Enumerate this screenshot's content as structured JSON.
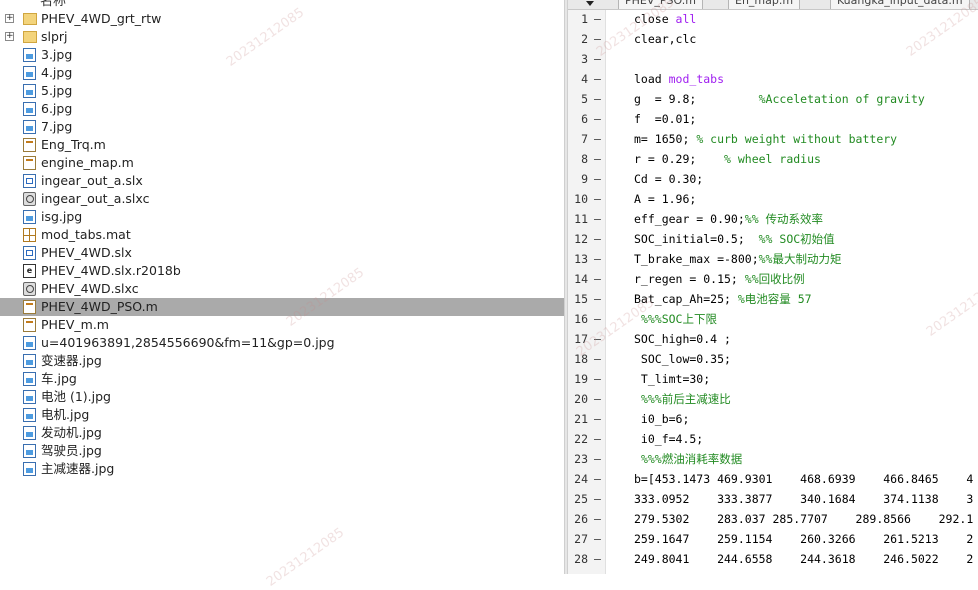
{
  "file_browser": {
    "header_clip": "名称",
    "items": [
      {
        "name": "PHEV_4WD_grt_rtw",
        "type": "folder",
        "expandable": true,
        "selected": false
      },
      {
        "name": "slprj",
        "type": "folder",
        "expandable": true,
        "selected": false
      },
      {
        "name": "3.jpg",
        "type": "jpg",
        "expandable": false,
        "selected": false
      },
      {
        "name": "4.jpg",
        "type": "jpg",
        "expandable": false,
        "selected": false
      },
      {
        "name": "5.jpg",
        "type": "jpg",
        "expandable": false,
        "selected": false
      },
      {
        "name": "6.jpg",
        "type": "jpg",
        "expandable": false,
        "selected": false
      },
      {
        "name": "7.jpg",
        "type": "jpg",
        "expandable": false,
        "selected": false
      },
      {
        "name": "Eng_Trq.m",
        "type": "m",
        "expandable": false,
        "selected": false
      },
      {
        "name": "engine_map.m",
        "type": "m",
        "expandable": false,
        "selected": false
      },
      {
        "name": "ingear_out_a.slx",
        "type": "slx",
        "expandable": false,
        "selected": false
      },
      {
        "name": "ingear_out_a.slxc",
        "type": "slxc",
        "expandable": false,
        "selected": false
      },
      {
        "name": "isg.jpg",
        "type": "jpg",
        "expandable": false,
        "selected": false
      },
      {
        "name": "mod_tabs.mat",
        "type": "mat",
        "expandable": false,
        "selected": false
      },
      {
        "name": "PHEV_4WD.slx",
        "type": "slx",
        "expandable": false,
        "selected": false
      },
      {
        "name": "PHEV_4WD.slx.r2018b",
        "type": "r2018",
        "expandable": false,
        "selected": false
      },
      {
        "name": "PHEV_4WD.slxc",
        "type": "slxc",
        "expandable": false,
        "selected": false
      },
      {
        "name": "PHEV_4WD_PSO.m",
        "type": "m",
        "expandable": false,
        "selected": true
      },
      {
        "name": "PHEV_m.m",
        "type": "m",
        "expandable": false,
        "selected": false
      },
      {
        "name": "u=401963891,2854556690&fm=11&gp=0.jpg",
        "type": "jpg",
        "expandable": false,
        "selected": false
      },
      {
        "name": "变速器.jpg",
        "type": "jpg",
        "expandable": false,
        "selected": false
      },
      {
        "name": "车.jpg",
        "type": "jpg",
        "expandable": false,
        "selected": false
      },
      {
        "name": "电池 (1).jpg",
        "type": "jpg",
        "expandable": false,
        "selected": false
      },
      {
        "name": "电机.jpg",
        "type": "jpg",
        "expandable": false,
        "selected": false
      },
      {
        "name": "发动机.jpg",
        "type": "jpg",
        "expandable": false,
        "selected": false
      },
      {
        "name": "驾驶员.jpg",
        "type": "jpg",
        "expandable": false,
        "selected": false
      },
      {
        "name": "主减速器.jpg",
        "type": "jpg",
        "expandable": false,
        "selected": false
      }
    ]
  },
  "editor": {
    "tabs": [
      {
        "label": "PHEV_PSO.m"
      },
      {
        "label": "Eh_map.m"
      },
      {
        "label": "Kuangka_input_data.m"
      }
    ],
    "lines": [
      {
        "n": "1",
        "parts": [
          {
            "t": "close ",
            "c": ""
          },
          {
            "t": "all",
            "c": "str"
          }
        ]
      },
      {
        "n": "2",
        "parts": [
          {
            "t": "clear,clc",
            "c": ""
          }
        ]
      },
      {
        "n": "3",
        "parts": []
      },
      {
        "n": "4",
        "parts": [
          {
            "t": "load ",
            "c": ""
          },
          {
            "t": "mod_tabs",
            "c": "str"
          }
        ]
      },
      {
        "n": "5",
        "parts": [
          {
            "t": "g  = 9.8;         ",
            "c": ""
          },
          {
            "t": "%Acceletation of gravity",
            "c": "com"
          }
        ]
      },
      {
        "n": "6",
        "parts": [
          {
            "t": "f  =0.01;",
            "c": ""
          }
        ]
      },
      {
        "n": "7",
        "parts": [
          {
            "t": "m= 1650; ",
            "c": ""
          },
          {
            "t": "% curb weight without battery",
            "c": "com"
          }
        ]
      },
      {
        "n": "8",
        "parts": [
          {
            "t": "r = 0.29;    ",
            "c": ""
          },
          {
            "t": "% wheel radius",
            "c": "com"
          }
        ]
      },
      {
        "n": "9",
        "parts": [
          {
            "t": "Cd = 0.30;",
            "c": ""
          }
        ]
      },
      {
        "n": "10",
        "parts": [
          {
            "t": "A = 1.96;",
            "c": ""
          }
        ]
      },
      {
        "n": "11",
        "parts": [
          {
            "t": "eff_gear = 0.90;",
            "c": ""
          },
          {
            "t": "%% 传动系效率",
            "c": "com"
          }
        ]
      },
      {
        "n": "12",
        "parts": [
          {
            "t": "SOC_initial=0.5;  ",
            "c": ""
          },
          {
            "t": "%% SOC初始值",
            "c": "com"
          }
        ]
      },
      {
        "n": "13",
        "parts": [
          {
            "t": "T_brake_max =-800;",
            "c": ""
          },
          {
            "t": "%%最大制动力矩",
            "c": "com"
          }
        ]
      },
      {
        "n": "14",
        "parts": [
          {
            "t": "r_regen = 0.15; ",
            "c": ""
          },
          {
            "t": "%%回收比例",
            "c": "com"
          }
        ]
      },
      {
        "n": "15",
        "parts": [
          {
            "t": "Bat_cap_Ah=25; ",
            "c": ""
          },
          {
            "t": "%电池容量 57",
            "c": "com"
          }
        ]
      },
      {
        "n": "16",
        "parts": [
          {
            "t": " ",
            "c": ""
          },
          {
            "t": "%%%SOC上下限",
            "c": "com"
          }
        ]
      },
      {
        "n": "17",
        "parts": [
          {
            "t": "SOC_high=0.4 ;",
            "c": ""
          }
        ]
      },
      {
        "n": "18",
        "parts": [
          {
            "t": " SOC_low=0.35;",
            "c": ""
          }
        ]
      },
      {
        "n": "19",
        "parts": [
          {
            "t": " T_limt=30;",
            "c": ""
          }
        ]
      },
      {
        "n": "20",
        "parts": [
          {
            "t": " ",
            "c": ""
          },
          {
            "t": "%%%前后主减速比",
            "c": "com"
          }
        ]
      },
      {
        "n": "21",
        "parts": [
          {
            "t": " i0_b=6;",
            "c": ""
          }
        ]
      },
      {
        "n": "22",
        "parts": [
          {
            "t": " i0_f=4.5;",
            "c": ""
          }
        ]
      },
      {
        "n": "23",
        "parts": [
          {
            "t": " ",
            "c": ""
          },
          {
            "t": "%%%燃油消耗率数据",
            "c": "com"
          }
        ]
      },
      {
        "n": "24",
        "parts": [
          {
            "t": "b=[453.1473 469.9301    468.6939    466.8465    4",
            "c": ""
          }
        ]
      },
      {
        "n": "25",
        "parts": [
          {
            "t": "333.0952    333.3877    340.1684    374.1138    3",
            "c": ""
          }
        ]
      },
      {
        "n": "26",
        "parts": [
          {
            "t": "279.5302    283.037 285.7707    289.8566    292.1",
            "c": ""
          }
        ]
      },
      {
        "n": "27",
        "parts": [
          {
            "t": "259.1647    259.1154    260.3266    261.5213    2",
            "c": ""
          }
        ]
      },
      {
        "n": "28",
        "parts": [
          {
            "t": "249.8041    244.6558    244.3618    246.5022    2",
            "c": ""
          }
        ]
      }
    ]
  },
  "watermark_text": "20231212085"
}
